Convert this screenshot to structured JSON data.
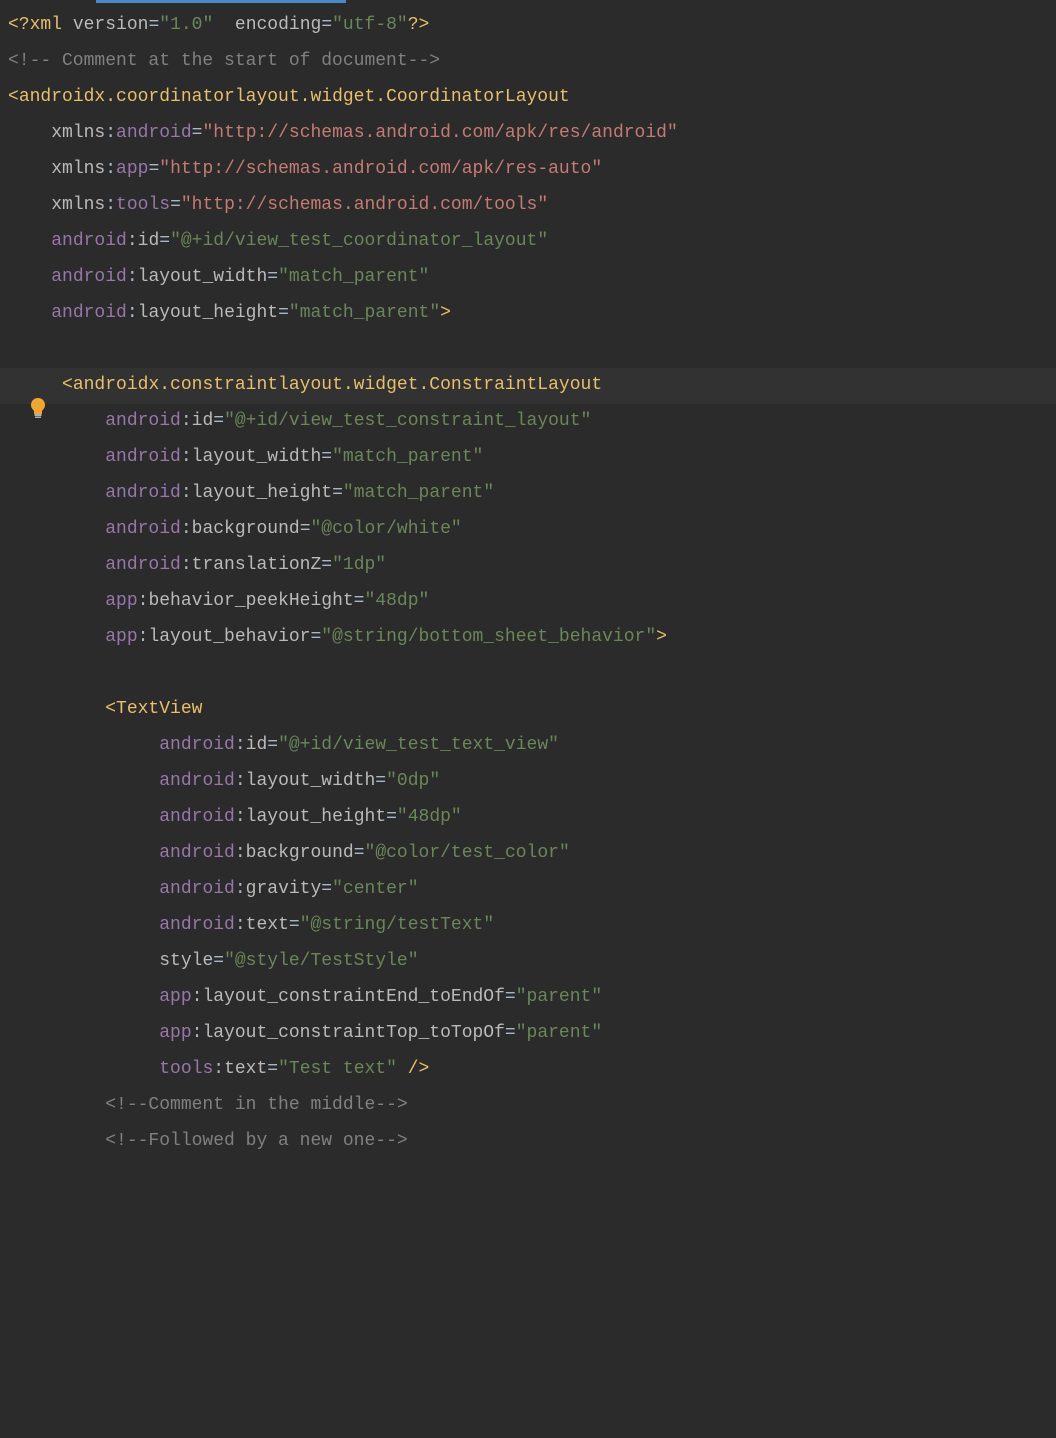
{
  "code": {
    "xml_decl": {
      "open": "<?",
      "xml": "xml",
      "version_k": "version",
      "version_v": "\"1.0\"",
      "encoding_k": "encoding",
      "encoding_v": "\"utf-8\"",
      "close": "?>"
    },
    "comment_top": "<!-- Comment at the start of document-->",
    "coordinator": {
      "tag": "androidx.coordinatorlayout.widget.CoordinatorLayout",
      "attrs": [
        {
          "ns": "xmlns",
          "name": "android",
          "val": "\"http://schemas.android.com/apk/res/android\"",
          "url": true
        },
        {
          "ns": "xmlns",
          "name": "app",
          "val": "\"http://schemas.android.com/apk/res-auto\"",
          "url": true
        },
        {
          "ns": "xmlns",
          "name": "tools",
          "val": "\"http://schemas.android.com/tools\"",
          "url": true
        },
        {
          "ns": "android",
          "name": "id",
          "val": "\"@+id/view_test_coordinator_layout\"",
          "url": false
        },
        {
          "ns": "android",
          "name": "layout_width",
          "val": "\"match_parent\"",
          "url": false
        },
        {
          "ns": "android",
          "name": "layout_height",
          "val": "\"match_parent\"",
          "url": false
        }
      ]
    },
    "constraint": {
      "tag": "androidx.constraintlayout.widget.ConstraintLayout",
      "attrs": [
        {
          "ns": "android",
          "name": "id",
          "val": "\"@+id/view_test_constraint_layout\"",
          "url": false
        },
        {
          "ns": "android",
          "name": "layout_width",
          "val": "\"match_parent\"",
          "url": false
        },
        {
          "ns": "android",
          "name": "layout_height",
          "val": "\"match_parent\"",
          "url": false
        },
        {
          "ns": "android",
          "name": "background",
          "val": "\"@color/white\"",
          "url": false
        },
        {
          "ns": "android",
          "name": "translationZ",
          "val": "\"1dp\"",
          "url": false
        },
        {
          "ns": "app",
          "name": "behavior_peekHeight",
          "val": "\"48dp\"",
          "url": false
        },
        {
          "ns": "app",
          "name": "layout_behavior",
          "val": "\"@string/bottom_sheet_behavior\"",
          "url": false
        }
      ]
    },
    "textview": {
      "tag": "TextView",
      "attrs": [
        {
          "ns": "android",
          "name": "id",
          "val": "\"@+id/view_test_text_view\"",
          "url": false
        },
        {
          "ns": "android",
          "name": "layout_width",
          "val": "\"0dp\"",
          "url": false
        },
        {
          "ns": "android",
          "name": "layout_height",
          "val": "\"48dp\"",
          "url": false
        },
        {
          "ns": "android",
          "name": "background",
          "val": "\"@color/test_color\"",
          "url": false
        },
        {
          "ns": "android",
          "name": "gravity",
          "val": "\"center\"",
          "url": false
        },
        {
          "ns": "android",
          "name": "text",
          "val": "\"@string/testText\"",
          "url": false
        },
        {
          "ns": "",
          "name": "style",
          "val": "\"@style/TestStyle\"",
          "url": false
        },
        {
          "ns": "app",
          "name": "layout_constraintEnd_toEndOf",
          "val": "\"parent\"",
          "url": false
        },
        {
          "ns": "app",
          "name": "layout_constraintTop_toTopOf",
          "val": "\"parent\"",
          "url": false
        },
        {
          "ns": "tools",
          "name": "text",
          "val": "\"Test text\"",
          "url": false
        }
      ]
    },
    "comment_mid1": "<!--Comment in the middle-->",
    "comment_mid2": "<!--Followed by a new one-->",
    "close_selfclose": " />",
    "angle_close": ">",
    "angle_open": "<"
  }
}
